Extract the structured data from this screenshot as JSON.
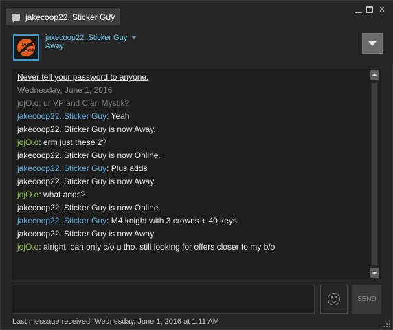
{
  "tab": {
    "title": "jakecoop22..Sticker Guy",
    "close_glyph": "✕"
  },
  "window_controls": {
    "minimize": "",
    "maximize": "",
    "close": "✕"
  },
  "friend": {
    "name": "jakecoop22..Sticker Guy",
    "status": "Away",
    "avatar_text": "JAKE COOP"
  },
  "chat": {
    "warning": "Never tell your password to anyone.",
    "date_header": "Wednesday, June 1, 2016",
    "lines": [
      {
        "kind": "old",
        "name": "jojO.o",
        "sep": ": ",
        "text": "ur VP and Clan Mystik?"
      },
      {
        "kind": "friend",
        "name": "jakecoop22..Sticker Guy",
        "sep": ": ",
        "text": "Yeah"
      },
      {
        "kind": "status",
        "name": "",
        "sep": "",
        "text": "jakecoop22..Sticker Guy is now Away."
      },
      {
        "kind": "self",
        "name": "jojO.o",
        "sep": ": ",
        "text": "erm just these 2?"
      },
      {
        "kind": "status",
        "name": "",
        "sep": "",
        "text": "jakecoop22..Sticker Guy is now Online."
      },
      {
        "kind": "friend",
        "name": "jakecoop22..Sticker Guy",
        "sep": ": ",
        "text": "Plus adds"
      },
      {
        "kind": "status",
        "name": "",
        "sep": "",
        "text": "jakecoop22..Sticker Guy is now Away."
      },
      {
        "kind": "self",
        "name": "jojO.o",
        "sep": ": ",
        "text": "what adds?"
      },
      {
        "kind": "status",
        "name": "",
        "sep": "",
        "text": "jakecoop22..Sticker Guy is now Online."
      },
      {
        "kind": "friend",
        "name": "jakecoop22..Sticker Guy",
        "sep": ": ",
        "text": "M4 knight with 3 crowns + 40 keys"
      },
      {
        "kind": "status",
        "name": "",
        "sep": "",
        "text": "jakecoop22..Sticker Guy is now Away."
      },
      {
        "kind": "self",
        "name": "jojO.o",
        "sep": ": ",
        "text": "alright, can only c/o u tho. still looking for offers closer to my b/o"
      }
    ]
  },
  "composer": {
    "value": "",
    "send_label": "SEND"
  },
  "footer": {
    "last_message": "Last message received: Wednesday, June 1, 2016 at 1:11 AM"
  },
  "colors": {
    "background": "#262626",
    "chat_bg": "#1e1e1e",
    "friend_blue": "#5eb3e6",
    "self_green": "#8bc53f",
    "text": "#eaeaea"
  }
}
